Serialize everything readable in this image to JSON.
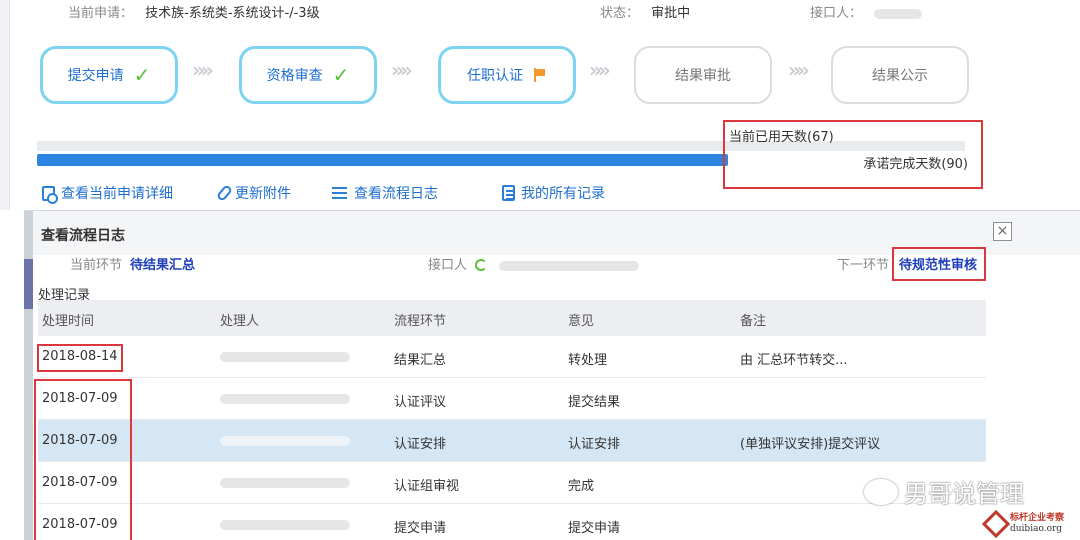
{
  "header": {
    "application_label": "当前申请：",
    "application_value": "技术族-系统类-系统设计-/-3级",
    "status_label": "状态：",
    "status_value": "审批中",
    "contact_label": "接口人："
  },
  "steps": [
    {
      "label": "提交申请",
      "state": "done"
    },
    {
      "label": "资格审查",
      "state": "done"
    },
    {
      "label": "任职认证",
      "state": "current"
    },
    {
      "label": "结果审批",
      "state": "pending"
    },
    {
      "label": "结果公示",
      "state": "pending"
    }
  ],
  "progress": {
    "used_label": "当前已用天数(67)",
    "promised_label": "承诺完成天数(90)",
    "used_days": 67,
    "promised_days": 90
  },
  "actions": [
    {
      "label": "查看当前申请详细",
      "icon": "doc-search-icon"
    },
    {
      "label": "更新附件",
      "icon": "paperclip-icon"
    },
    {
      "label": "查看流程日志",
      "icon": "list-icon"
    },
    {
      "label": "我的所有记录",
      "icon": "notepad-icon"
    }
  ],
  "modal": {
    "title": "查看流程日志",
    "close": "×",
    "current_node_label": "当前环节",
    "current_node_value": "待结果汇总",
    "contact_label": "接口人",
    "next_node_label": "下一环节",
    "next_node_value": "待规范性审核",
    "records_label": "处理记录",
    "columns": [
      "处理时间",
      "处理人",
      "流程环节",
      "意见",
      "备注"
    ],
    "rows": [
      {
        "time": "2018-08-14",
        "node": "结果汇总",
        "opinion": "转处理",
        "note": "由                        汇总环节转交..."
      },
      {
        "time": "2018-07-09",
        "node": "认证评议",
        "opinion": "提交结果",
        "note": ""
      },
      {
        "time": "2018-07-09",
        "node": "认证安排",
        "opinion": "认证安排",
        "note": "(单独评议安排)提交评议"
      },
      {
        "time": "2018-07-09",
        "node": "认证组审视",
        "opinion": "完成",
        "note": ""
      },
      {
        "time": "2018-07-09",
        "node": "提交申请",
        "opinion": "提交申请",
        "note": ""
      }
    ]
  },
  "watermark": {
    "text": "男哥说管理",
    "logo_line1": "标杆企业考察",
    "logo_line2": "duibiao.org"
  },
  "colors": {
    "accent": "#2a86e0",
    "step_border": "#7dd3f0",
    "highlight_red": "#d9383e",
    "selected_row": "#d5e6f5",
    "check_green": "#5cc03a",
    "flag_orange": "#f29a2e"
  }
}
